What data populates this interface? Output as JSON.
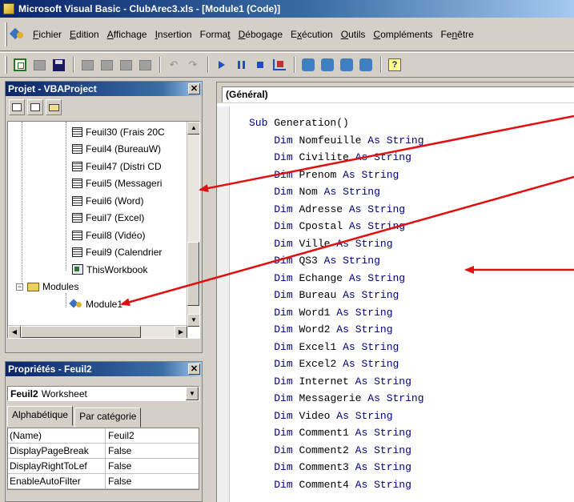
{
  "window": {
    "title": "Microsoft Visual Basic - ClubArec3.xls - [Module1 (Code)]"
  },
  "menu": [
    {
      "label": "Fichier",
      "acc": "F",
      "rest": "ichier"
    },
    {
      "label": "Edition",
      "acc": "E",
      "rest": "dition"
    },
    {
      "label": "Affichage",
      "acc": "A",
      "rest": "ffichage"
    },
    {
      "label": "Insertion",
      "acc": "I",
      "rest": "nsertion"
    },
    {
      "label": "Format",
      "pre": "Forma",
      "acc": "t",
      "rest": ""
    },
    {
      "label": "Débogage",
      "acc": "D",
      "rest": "ébogage"
    },
    {
      "label": "Exécution",
      "pre": "E",
      "acc": "x",
      "rest": "écution"
    },
    {
      "label": "Outils",
      "acc": "O",
      "rest": "utils"
    },
    {
      "label": "Compléments",
      "acc": "C",
      "rest": "ompléments"
    },
    {
      "label": "Fenêtre",
      "pre": "Fe",
      "acc": "n",
      "rest": "être"
    }
  ],
  "project_panel": {
    "title": "Projet - VBAProject",
    "close": "✕",
    "tree": [
      {
        "label": "Feuil30 (Frais 20C",
        "type": "sheet"
      },
      {
        "label": "Feuil4 (BureauW)",
        "type": "sheet"
      },
      {
        "label": "Feuil47 (Distri CD",
        "type": "sheet"
      },
      {
        "label": "Feuil5 (Messageri",
        "type": "sheet"
      },
      {
        "label": "Feuil6 (Word)",
        "type": "sheet"
      },
      {
        "label": "Feuil7 (Excel)",
        "type": "sheet"
      },
      {
        "label": "Feuil8 (Vidéo)",
        "type": "sheet"
      },
      {
        "label": "Feuil9 (Calendrier",
        "type": "sheet"
      },
      {
        "label": "ThisWorkbook",
        "type": "workbook"
      },
      {
        "label": "Modules",
        "type": "folder"
      },
      {
        "label": "Module1",
        "type": "module"
      }
    ]
  },
  "properties_panel": {
    "title": "Propriétés - Feuil2",
    "close": "✕",
    "object_name": "Feuil2",
    "object_type": "Worksheet",
    "tabs": [
      "Alphabétique",
      "Par catégorie"
    ],
    "rows": [
      {
        "key": "(Name)",
        "value": "Feuil2"
      },
      {
        "key": "DisplayPageBreak",
        "value": "False"
      },
      {
        "key": "DisplayRightToLef",
        "value": "False"
      },
      {
        "key": "EnableAutoFilter",
        "value": "False"
      }
    ]
  },
  "code_window": {
    "object_combo": "(Général)",
    "sub_keyword": "Sub",
    "sub_name": "Generation()",
    "dim_keyword": "Dim",
    "as_keyword": "As",
    "type_keyword": "String",
    "variables": [
      "Nomfeuille",
      "Civilite",
      "Prenom",
      "Nom",
      "Adresse",
      "Cpostal",
      "Ville",
      "QS3",
      "Echange",
      "Bureau",
      "Word1",
      "Word2",
      "Excel1",
      "Excel2",
      "Internet",
      "Messagerie",
      "Video",
      "Comment1",
      "Comment2",
      "Comment3",
      "Comment4"
    ]
  },
  "colors": {
    "annotation_arrow": "#e01010",
    "keyword": "#00007f",
    "title_bar": "#0a246a"
  }
}
